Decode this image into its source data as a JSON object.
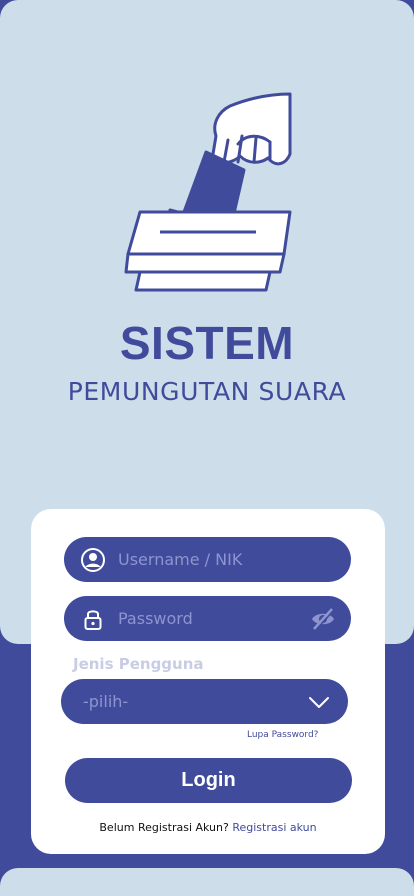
{
  "app": {
    "title": "SISTEM",
    "subtitle": "PEMUNGUTAN SUARA"
  },
  "form": {
    "username_placeholder": "Username / NIK",
    "password_placeholder": "Password",
    "user_type_label": "Jenis Pengguna",
    "user_type_selected": "-pilih-",
    "forgot_password": "Lupa Password?",
    "login_label": "Login",
    "register_prompt": "Belum Registrasi Akun?",
    "register_link": "Registrasi akun"
  },
  "icons": {
    "username": "user-circle-icon",
    "password": "lock-icon",
    "toggle_password": "eye-off-icon",
    "dropdown": "chevron-down-icon"
  },
  "colors": {
    "primary": "#414b9c",
    "background_light": "#cddde9",
    "card": "#ffffff",
    "placeholder": "#8d95cf",
    "label_muted": "#c9cde4"
  }
}
